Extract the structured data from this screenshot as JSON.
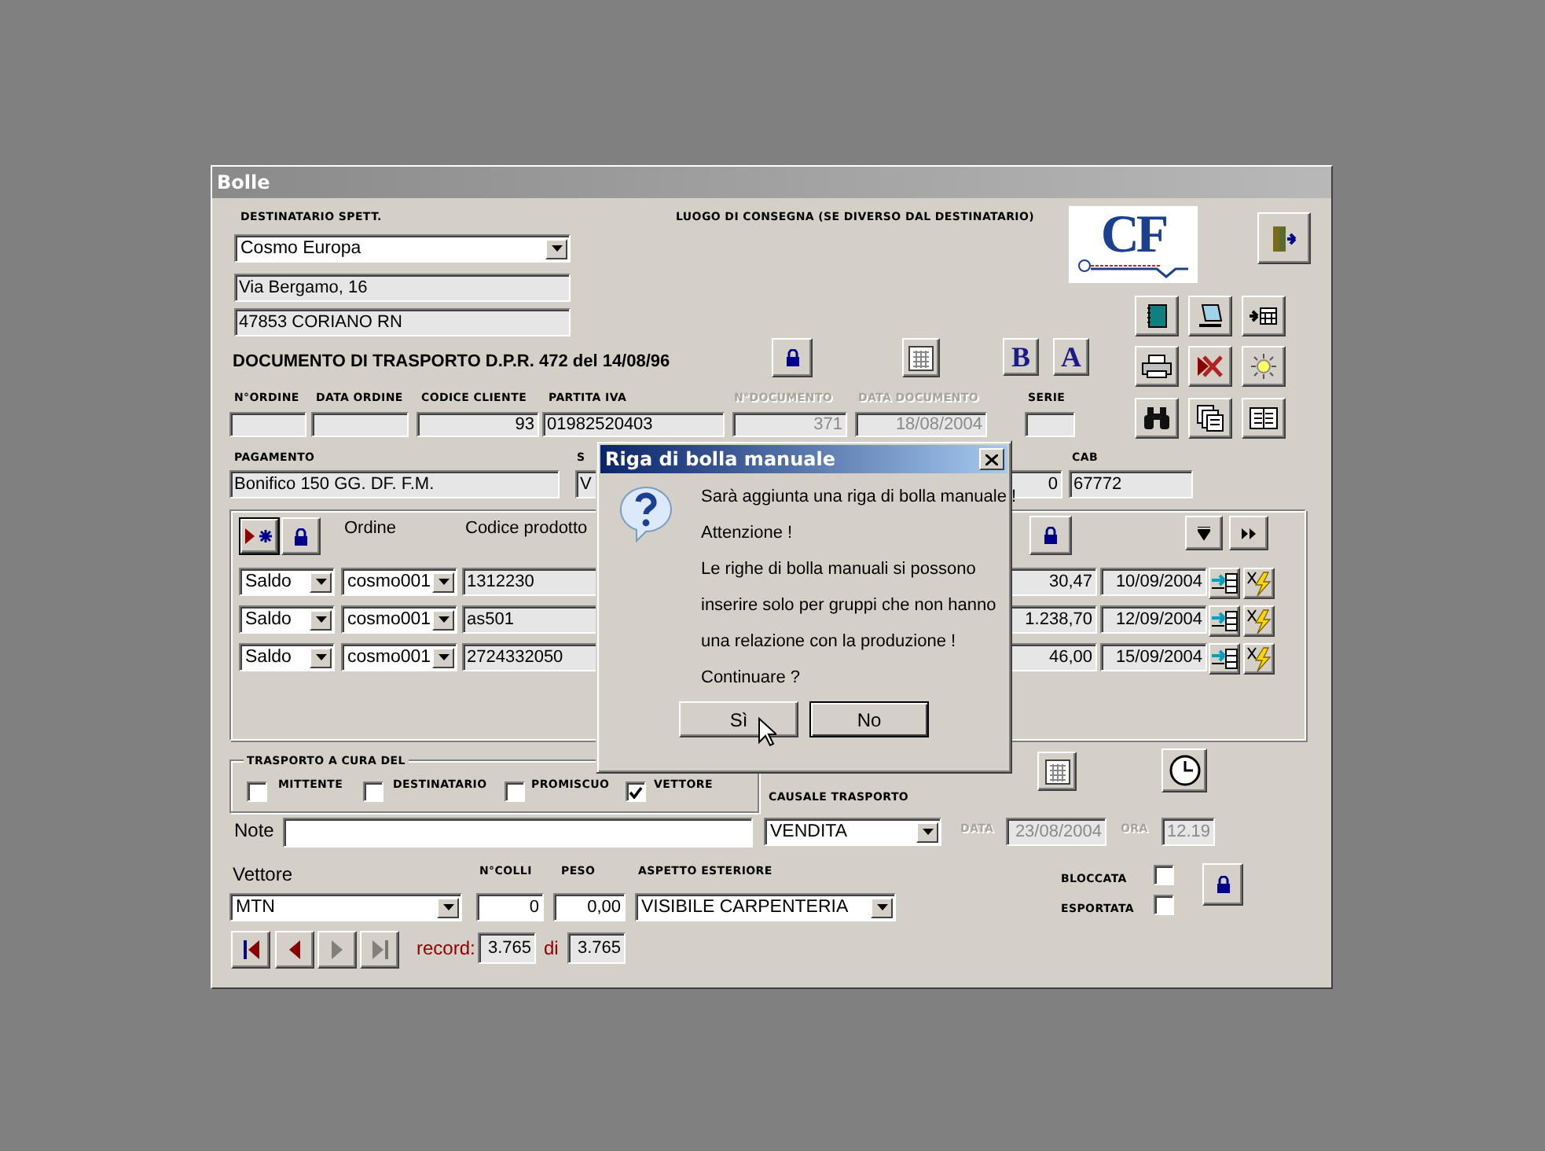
{
  "window": {
    "title": "Bolle"
  },
  "logo": {
    "text": "CF"
  },
  "header": {
    "recipient_label": "DESTINATARIO SPETT.",
    "recipient": "Cosmo Europa",
    "address": "Via Bergamo, 16",
    "city": "47853 CORIANO RN",
    "delivery_label": "LUOGO DI CONSEGNA (SE DIVERSO DAL DESTINATARIO)",
    "doc_title": "DOCUMENTO DI TRASPORTO D.P.R. 472 del 14/08/96"
  },
  "format_buttons": [
    "B",
    "A"
  ],
  "fields": [
    {
      "label": "N°ORDINE",
      "disabled": false
    },
    {
      "label": "DATA ORDINE",
      "disabled": false
    },
    {
      "label": "CODICE CLIENTE",
      "value": "93",
      "disabled": false
    },
    {
      "label": "PARTITA IVA",
      "value": "01982520403",
      "disabled": false
    },
    {
      "label": "N°DOCUMENTO",
      "value": "371",
      "disabled": true
    },
    {
      "label": "DATA DOCUMENTO",
      "value": "18/08/2004",
      "disabled": true
    },
    {
      "label": "SERIE",
      "disabled": false
    }
  ],
  "payment": {
    "label": "PAGAMENTO",
    "value": "Bonifico 150 GG. DF. F.M."
  },
  "column_2": {
    "label": "S",
    "value": "V"
  },
  "column_3": {
    "value": "0"
  },
  "cab": {
    "label": "CAB",
    "value": "67772"
  },
  "subform": {
    "columns": [
      "Ordine",
      "Codice prodotto"
    ],
    "rows": [
      {
        "type": "Saldo",
        "order": "cosmo001",
        "code": "1312230",
        "amount": "30,47",
        "date": "10/09/2004"
      },
      {
        "type": "Saldo",
        "order": "cosmo001",
        "code": "as501",
        "amount": "1.238,70",
        "date": "12/09/2004"
      },
      {
        "type": "Saldo",
        "order": "cosmo001",
        "code": "2724332050",
        "amount": "46,00",
        "date": "15/09/2004"
      }
    ]
  },
  "transport": {
    "title": "TRASPORTO A CURA DEL",
    "options": [
      {
        "label": "MITTENTE",
        "checked": false
      },
      {
        "label": "DESTINATARIO",
        "checked": false
      },
      {
        "label": "PROMISCUO",
        "checked": false
      },
      {
        "label": "VETTORE",
        "checked": true
      }
    ]
  },
  "note": {
    "label": "Note"
  },
  "causale": {
    "label": "CAUSALE TRASPORTO",
    "value": "VENDITA"
  },
  "date": {
    "label": "DATA",
    "value": "23/08/2004",
    "disabled": true
  },
  "time": {
    "label": "ORA",
    "value": "12.19",
    "disabled": true
  },
  "carrier": {
    "label": "Vettore",
    "value": "MTN"
  },
  "packages": {
    "label": "N°COLLI",
    "value": "0"
  },
  "weight": {
    "label": "PESO",
    "value": "0,00"
  },
  "appearance": {
    "label": "ASPETTO ESTERIORE",
    "value": "VISIBILE CARPENTERIA"
  },
  "flags": [
    {
      "label": "BLOCCATA",
      "checked": false
    },
    {
      "label": "ESPORTATA",
      "checked": false
    }
  ],
  "navigation": [
    {
      "kind": "first",
      "disabled": false
    },
    {
      "kind": "previous",
      "disabled": false
    },
    {
      "kind": "next",
      "disabled": true
    },
    {
      "kind": "last",
      "disabled": true
    }
  ],
  "record": {
    "label": "record:",
    "current": "3.765",
    "of": "di",
    "total": "3.765"
  },
  "dialog": {
    "title": "Riga di bolla manuale",
    "lines": [
      "Sarà aggiunta una riga di bolla manuale !",
      "Attenzione !",
      "Le righe di bolla manuali si possono",
      "inserire solo per gruppi che non hanno",
      "una relazione con la produzione !",
      "Continuare  ?"
    ],
    "buttons": [
      {
        "label": "Sì",
        "default": false
      },
      {
        "label": "No",
        "default": true
      }
    ]
  }
}
